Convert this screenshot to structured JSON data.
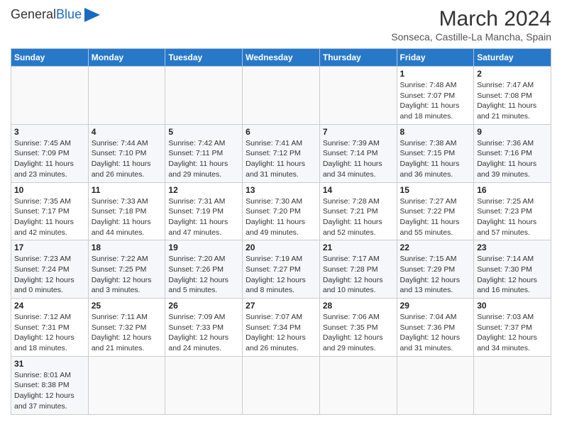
{
  "header": {
    "logo_general": "General",
    "logo_blue": "Blue",
    "month_year": "March 2024",
    "location": "Sonseca, Castille-La Mancha, Spain"
  },
  "weekdays": [
    "Sunday",
    "Monday",
    "Tuesday",
    "Wednesday",
    "Thursday",
    "Friday",
    "Saturday"
  ],
  "weeks": [
    [
      {
        "day": "",
        "info": ""
      },
      {
        "day": "",
        "info": ""
      },
      {
        "day": "",
        "info": ""
      },
      {
        "day": "",
        "info": ""
      },
      {
        "day": "",
        "info": ""
      },
      {
        "day": "1",
        "info": "Sunrise: 7:48 AM\nSunset: 7:07 PM\nDaylight: 11 hours and 18 minutes."
      },
      {
        "day": "2",
        "info": "Sunrise: 7:47 AM\nSunset: 7:08 PM\nDaylight: 11 hours and 21 minutes."
      }
    ],
    [
      {
        "day": "3",
        "info": "Sunrise: 7:45 AM\nSunset: 7:09 PM\nDaylight: 11 hours and 23 minutes."
      },
      {
        "day": "4",
        "info": "Sunrise: 7:44 AM\nSunset: 7:10 PM\nDaylight: 11 hours and 26 minutes."
      },
      {
        "day": "5",
        "info": "Sunrise: 7:42 AM\nSunset: 7:11 PM\nDaylight: 11 hours and 29 minutes."
      },
      {
        "day": "6",
        "info": "Sunrise: 7:41 AM\nSunset: 7:12 PM\nDaylight: 11 hours and 31 minutes."
      },
      {
        "day": "7",
        "info": "Sunrise: 7:39 AM\nSunset: 7:14 PM\nDaylight: 11 hours and 34 minutes."
      },
      {
        "day": "8",
        "info": "Sunrise: 7:38 AM\nSunset: 7:15 PM\nDaylight: 11 hours and 36 minutes."
      },
      {
        "day": "9",
        "info": "Sunrise: 7:36 AM\nSunset: 7:16 PM\nDaylight: 11 hours and 39 minutes."
      }
    ],
    [
      {
        "day": "10",
        "info": "Sunrise: 7:35 AM\nSunset: 7:17 PM\nDaylight: 11 hours and 42 minutes."
      },
      {
        "day": "11",
        "info": "Sunrise: 7:33 AM\nSunset: 7:18 PM\nDaylight: 11 hours and 44 minutes."
      },
      {
        "day": "12",
        "info": "Sunrise: 7:31 AM\nSunset: 7:19 PM\nDaylight: 11 hours and 47 minutes."
      },
      {
        "day": "13",
        "info": "Sunrise: 7:30 AM\nSunset: 7:20 PM\nDaylight: 11 hours and 49 minutes."
      },
      {
        "day": "14",
        "info": "Sunrise: 7:28 AM\nSunset: 7:21 PM\nDaylight: 11 hours and 52 minutes."
      },
      {
        "day": "15",
        "info": "Sunrise: 7:27 AM\nSunset: 7:22 PM\nDaylight: 11 hours and 55 minutes."
      },
      {
        "day": "16",
        "info": "Sunrise: 7:25 AM\nSunset: 7:23 PM\nDaylight: 11 hours and 57 minutes."
      }
    ],
    [
      {
        "day": "17",
        "info": "Sunrise: 7:23 AM\nSunset: 7:24 PM\nDaylight: 12 hours and 0 minutes."
      },
      {
        "day": "18",
        "info": "Sunrise: 7:22 AM\nSunset: 7:25 PM\nDaylight: 12 hours and 3 minutes."
      },
      {
        "day": "19",
        "info": "Sunrise: 7:20 AM\nSunset: 7:26 PM\nDaylight: 12 hours and 5 minutes."
      },
      {
        "day": "20",
        "info": "Sunrise: 7:19 AM\nSunset: 7:27 PM\nDaylight: 12 hours and 8 minutes."
      },
      {
        "day": "21",
        "info": "Sunrise: 7:17 AM\nSunset: 7:28 PM\nDaylight: 12 hours and 10 minutes."
      },
      {
        "day": "22",
        "info": "Sunrise: 7:15 AM\nSunset: 7:29 PM\nDaylight: 12 hours and 13 minutes."
      },
      {
        "day": "23",
        "info": "Sunrise: 7:14 AM\nSunset: 7:30 PM\nDaylight: 12 hours and 16 minutes."
      }
    ],
    [
      {
        "day": "24",
        "info": "Sunrise: 7:12 AM\nSunset: 7:31 PM\nDaylight: 12 hours and 18 minutes."
      },
      {
        "day": "25",
        "info": "Sunrise: 7:11 AM\nSunset: 7:32 PM\nDaylight: 12 hours and 21 minutes."
      },
      {
        "day": "26",
        "info": "Sunrise: 7:09 AM\nSunset: 7:33 PM\nDaylight: 12 hours and 24 minutes."
      },
      {
        "day": "27",
        "info": "Sunrise: 7:07 AM\nSunset: 7:34 PM\nDaylight: 12 hours and 26 minutes."
      },
      {
        "day": "28",
        "info": "Sunrise: 7:06 AM\nSunset: 7:35 PM\nDaylight: 12 hours and 29 minutes."
      },
      {
        "day": "29",
        "info": "Sunrise: 7:04 AM\nSunset: 7:36 PM\nDaylight: 12 hours and 31 minutes."
      },
      {
        "day": "30",
        "info": "Sunrise: 7:03 AM\nSunset: 7:37 PM\nDaylight: 12 hours and 34 minutes."
      }
    ],
    [
      {
        "day": "31",
        "info": "Sunrise: 8:01 AM\nSunset: 8:38 PM\nDaylight: 12 hours and 37 minutes."
      },
      {
        "day": "",
        "info": ""
      },
      {
        "day": "",
        "info": ""
      },
      {
        "day": "",
        "info": ""
      },
      {
        "day": "",
        "info": ""
      },
      {
        "day": "",
        "info": ""
      },
      {
        "day": "",
        "info": ""
      }
    ]
  ]
}
